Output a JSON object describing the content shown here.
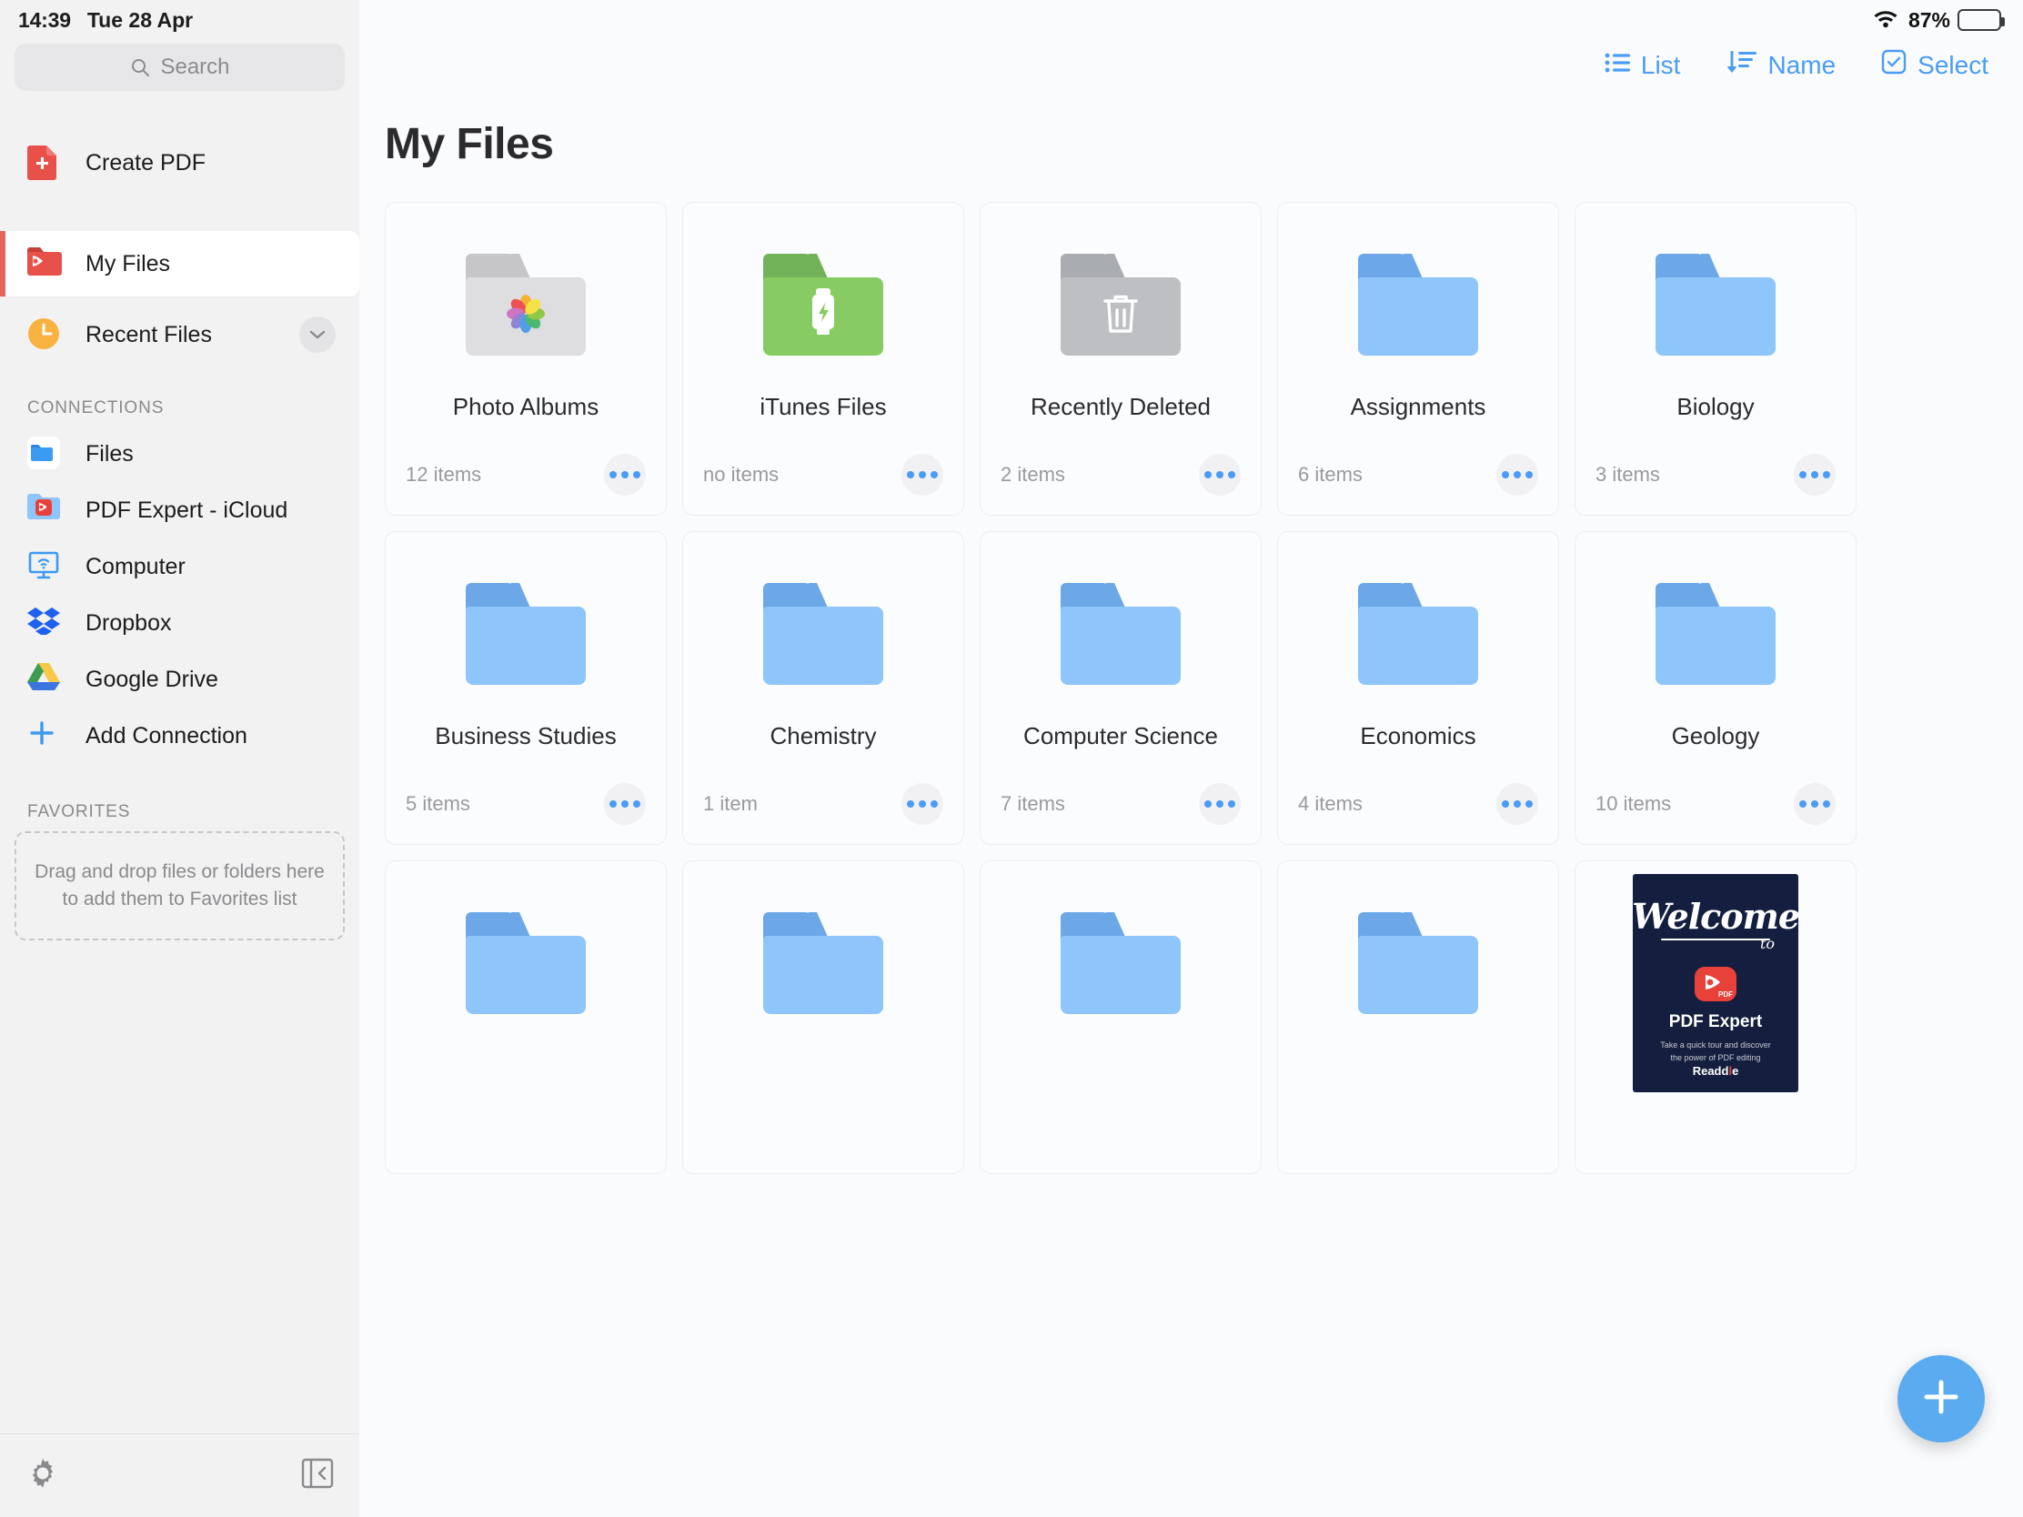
{
  "status_bar": {
    "time": "14:39",
    "date": "Tue 28 Apr",
    "wifi_icon": "wifi-icon",
    "battery_percent": "87%",
    "battery_icon": "battery-icon"
  },
  "sidebar": {
    "search": {
      "placeholder": "Search",
      "value": "",
      "icon": "search-icon"
    },
    "create_pdf": {
      "label": "Create PDF",
      "icon": "create-pdf-icon"
    },
    "primary_items": [
      {
        "label": "My Files",
        "icon": "red-folder-pdf-icon",
        "selected": true
      },
      {
        "label": "Recent Files",
        "icon": "clock-icon",
        "selected": false,
        "chevron": "chevron-down-icon"
      }
    ],
    "connections_header": "CONNECTIONS",
    "connections": [
      {
        "label": "Files",
        "icon": "blue-folder-icon"
      },
      {
        "label": "PDF Expert - iCloud",
        "icon": "pdf-expert-icloud-icon"
      },
      {
        "label": "Computer",
        "icon": "computer-wifi-icon"
      },
      {
        "label": "Dropbox",
        "icon": "dropbox-icon"
      },
      {
        "label": "Add Connection",
        "icon": "plus-icon"
      }
    ],
    "favorites_header": "FAVORITES",
    "favorites_dropzone": "Drag and drop files or folders here to add them to Favorites list",
    "footer": {
      "settings_icon": "gear-icon",
      "collapse_icon": "collapse-sidebar-icon"
    },
    "google_drive": {
      "label": "Google Drive",
      "icon": "google-drive-icon"
    }
  },
  "toolbar": {
    "view_mode": {
      "label": "List",
      "icon": "list-icon"
    },
    "sort": {
      "label": "Name",
      "icon": "sort-down-icon"
    },
    "select": {
      "label": "Select",
      "icon": "checkbox-icon"
    },
    "accent_color": "#4a9cf6"
  },
  "main": {
    "title": "My Files",
    "items": [
      {
        "name": "Photo Albums",
        "count": "12 items",
        "folder_style": "f-gray",
        "glyph": "photos-icon"
      },
      {
        "name": "iTunes Files",
        "count": "no items",
        "folder_style": "f-green",
        "glyph": "usb-drive-icon"
      },
      {
        "name": "Recently Deleted",
        "count": "2 items",
        "folder_style": "f-dgray",
        "glyph": "trash-icon"
      },
      {
        "name": "Assignments",
        "count": "6 items",
        "folder_style": "f-blue",
        "glyph": ""
      },
      {
        "name": "Biology",
        "count": "3 items",
        "folder_style": "f-blue",
        "glyph": ""
      },
      {
        "name": "Business Studies",
        "count": "5 items",
        "folder_style": "f-blue",
        "glyph": ""
      },
      {
        "name": "Chemistry",
        "count": "1 item",
        "folder_style": "f-blue",
        "glyph": ""
      },
      {
        "name": "Computer Science",
        "count": "7 items",
        "folder_style": "f-blue",
        "glyph": ""
      },
      {
        "name": "Economics",
        "count": "4 items",
        "folder_style": "f-blue",
        "glyph": ""
      },
      {
        "name": "Geology",
        "count": "10 items",
        "folder_style": "f-blue",
        "glyph": ""
      },
      {
        "name": "",
        "count": "",
        "folder_style": "f-blue",
        "glyph": ""
      },
      {
        "name": "",
        "count": "",
        "folder_style": "f-blue",
        "glyph": ""
      },
      {
        "name": "",
        "count": "",
        "folder_style": "f-blue",
        "glyph": ""
      },
      {
        "name": "",
        "count": "",
        "folder_style": "f-blue",
        "glyph": ""
      }
    ],
    "welcome_document": {
      "heading": "Welcome",
      "heading_suffix": "to",
      "app_name": "PDF Expert",
      "app_badge": "PDF",
      "subtitle": "Take a quick tour and discover the power of PDF editing",
      "publisher": "Readdle"
    },
    "fab": {
      "icon": "plus-icon",
      "color": "#5aabf0"
    }
  }
}
